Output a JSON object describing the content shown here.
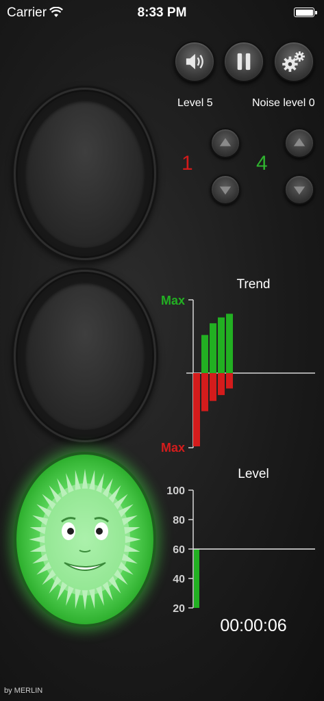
{
  "status_bar": {
    "carrier": "Carrier",
    "time": "8:33 PM"
  },
  "controls": {
    "sound_icon": "speaker-icon",
    "pause_icon": "pause-icon",
    "settings_icon": "gears-icon",
    "level_label": "Level 5",
    "noise_label": "Noise level 0",
    "left_counter": "1",
    "right_counter": "4",
    "left_counter_color": "#d21a1a",
    "right_counter_color": "#2fb32f"
  },
  "lights": {
    "active": "green",
    "face": "smiley-face"
  },
  "trend": {
    "title": "Trend",
    "top_label": "Max",
    "bottom_label": "Max",
    "top_color": "#22b022",
    "bottom_color": "#d41c1c"
  },
  "level": {
    "title": "Level",
    "timer": "00:00:06",
    "threshold": 60,
    "current": 60,
    "ticks": [
      "100",
      "80",
      "60",
      "40",
      "20"
    ]
  },
  "footer": {
    "credit": "by MERLIN"
  },
  "chart_data": [
    {
      "type": "bar",
      "title": "Trend",
      "ylabel_top": "Max",
      "ylabel_bottom": "Max",
      "series": [
        {
          "values": [
            0.52,
            0.68,
            0.76,
            0.81
          ]
        },
        {
          "values": [
            -1.0,
            -0.52,
            -0.38,
            -0.3,
            -0.21
          ]
        }
      ],
      "ylim": [
        -1,
        1
      ],
      "grid": false
    },
    {
      "type": "bar",
      "title": "Level",
      "categories": [
        ""
      ],
      "values": [
        60
      ],
      "yticks": [
        20,
        40,
        60,
        80,
        100
      ],
      "ylim": [
        20,
        100
      ],
      "reference_line": 60,
      "grid": false
    }
  ]
}
